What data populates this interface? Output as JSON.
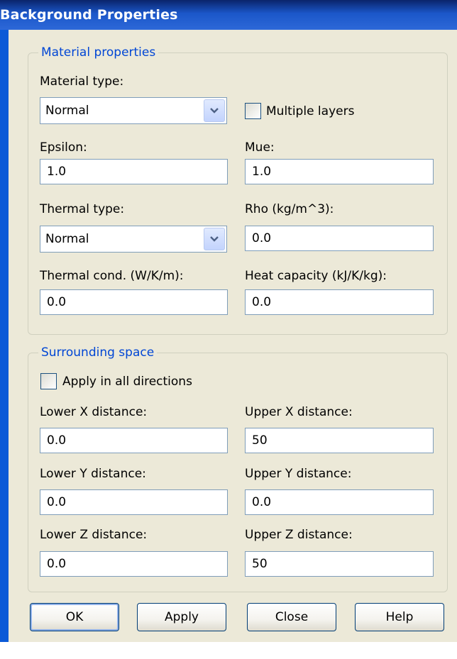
{
  "window": {
    "title": "Background Properties"
  },
  "material": {
    "legend": "Material properties",
    "material_type_label": "Material type:",
    "material_type_value": "Normal",
    "multiple_layers_label": "Multiple layers",
    "multiple_layers_checked": false,
    "epsilon_label": "Epsilon:",
    "epsilon_value": "1.0",
    "mue_label": "Mue:",
    "mue_value": "1.0",
    "thermal_type_label": "Thermal type:",
    "thermal_type_value": "Normal",
    "rho_label": "Rho (kg/m^3):",
    "rho_value": "0.0",
    "thermal_cond_label": "Thermal cond. (W/K/m):",
    "thermal_cond_value": "0.0",
    "heat_capacity_label": "Heat capacity (kJ/K/kg):",
    "heat_capacity_value": "0.0"
  },
  "surrounding": {
    "legend": "Surrounding space",
    "apply_all_label": "Apply in all directions",
    "apply_all_checked": false,
    "lower_x_label": "Lower X distance:",
    "lower_x_value": "0.0",
    "upper_x_label": "Upper X distance:",
    "upper_x_value": "50",
    "lower_y_label": "Lower Y distance:",
    "lower_y_value": "0.0",
    "upper_y_label": "Upper Y distance:",
    "upper_y_value": "0.0",
    "lower_z_label": "Lower Z distance:",
    "lower_z_value": "0.0",
    "upper_z_label": "Upper Z distance:",
    "upper_z_value": "50"
  },
  "buttons": {
    "ok": "OK",
    "apply": "Apply",
    "close": "Close",
    "help": "Help"
  },
  "colors": {
    "title_bar": "#0a246a",
    "legend_text": "#0046d5",
    "dialog_bg": "#ece9d8"
  }
}
